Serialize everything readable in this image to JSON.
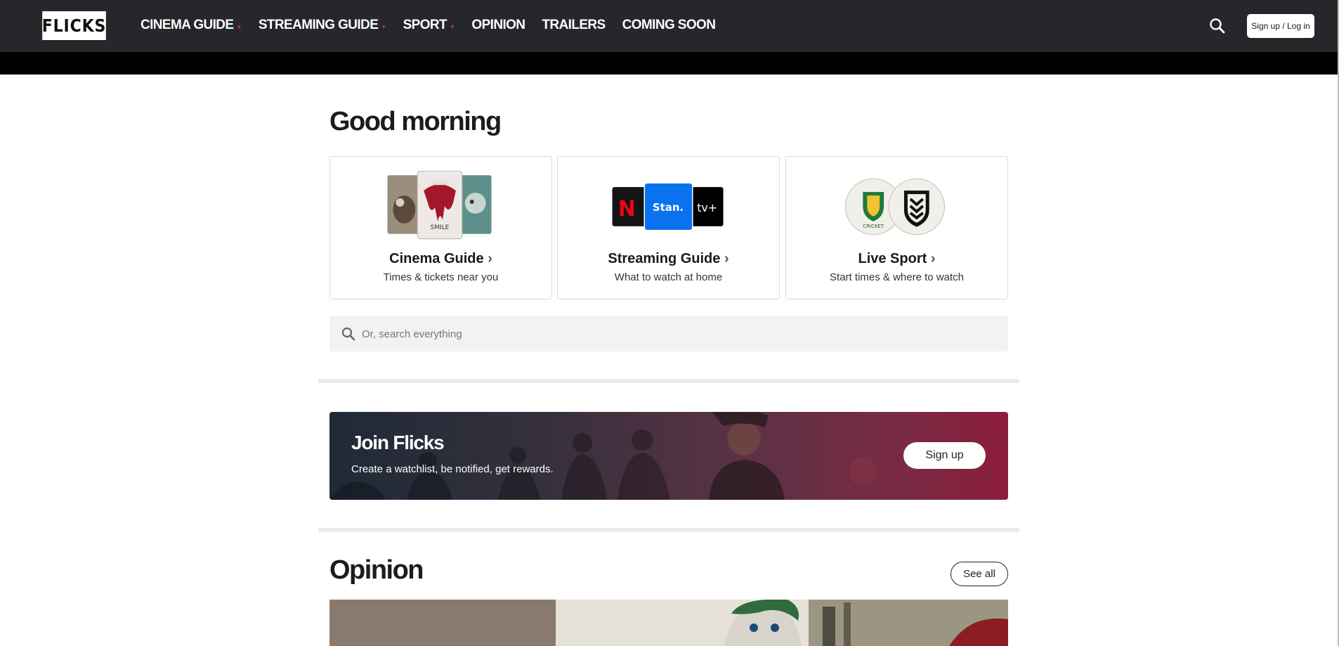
{
  "header": {
    "logo": "FLICKS",
    "nav": [
      {
        "label": "CINEMA GUIDE",
        "dropdown": true
      },
      {
        "label": "STREAMING GUIDE",
        "dropdown": true
      },
      {
        "label": "SPORT",
        "dropdown": true
      },
      {
        "label": "OPINION",
        "dropdown": false
      },
      {
        "label": "TRAILERS",
        "dropdown": false
      },
      {
        "label": "COMING SOON",
        "dropdown": false
      }
    ],
    "search_icon": "search-icon",
    "login_label": "Sign up / Log in"
  },
  "greeting": "Good morning",
  "cards": [
    {
      "title": "Cinema Guide",
      "subtitle": "Times & tickets near you",
      "art": "movie-posters"
    },
    {
      "title": "Streaming Guide",
      "subtitle": "What to watch at home",
      "art": "streaming-logos",
      "logos": [
        "N",
        "Stan.",
        "tv+"
      ]
    },
    {
      "title": "Live Sport",
      "subtitle": "Start times & where to watch",
      "art": "sport-badges",
      "badge_text": "CRICKET"
    }
  ],
  "search": {
    "placeholder": "Or, search everything"
  },
  "join": {
    "title": "Join Flicks",
    "subtitle": "Create a watchlist, be notified, get rewards.",
    "button": "Sign up"
  },
  "opinion": {
    "title": "Opinion",
    "see_all": "See all"
  },
  "colors": {
    "nav_bg": "#26272b",
    "nav_accent": "#e0264a",
    "stan_blue": "#0a72ef",
    "netflix_red": "#e50914"
  }
}
